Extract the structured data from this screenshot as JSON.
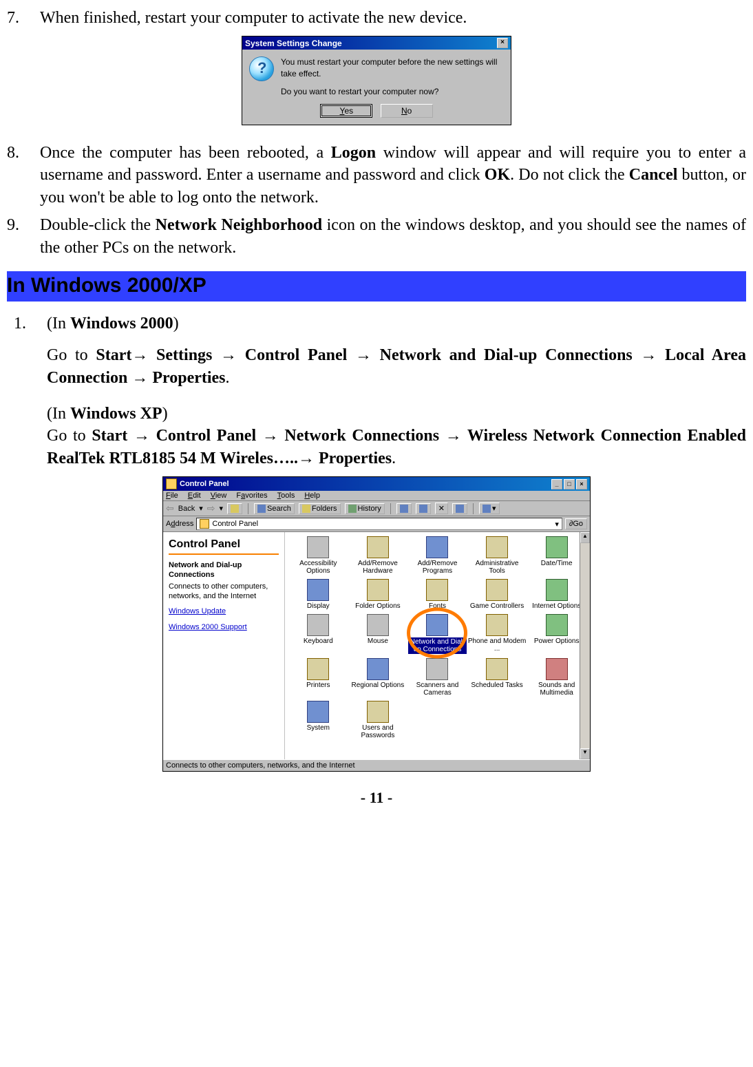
{
  "step7": {
    "num": "7.",
    "text": "When finished, restart your computer to activate the new device."
  },
  "dialog": {
    "title": "System Settings Change",
    "close": "×",
    "line1": "You must restart your computer before the new settings will take effect.",
    "line2": "Do you want to restart your computer now?",
    "yes_u": "Y",
    "yes_rest": "es",
    "no_u": "N",
    "no_rest": "o"
  },
  "step8": {
    "num": "8.",
    "pre": "Once the computer has been rebooted, a ",
    "logon": "Logon",
    "mid1": " window will appear and will require you to enter a username and password. Enter a username and password and click ",
    "ok": "OK",
    "mid2": ".  Do not click the ",
    "cancel": "Cancel",
    "tail": " button, or you won't be able to log onto the network."
  },
  "step9": {
    "num": "9.",
    "pre": "Double-click the ",
    "nn": "Network Neighborhood",
    "tail": " icon on the windows desktop, and you should see the names of the other PCs on the network."
  },
  "section_header": "In Windows 2000/XP",
  "step1": {
    "num": "1.",
    "paren_pre": "(In ",
    "w2000": "Windows 2000",
    "paren_post": ")",
    "w2000_path_pre": "Go to ",
    "w2000_path": "Start→ Settings → Control Panel → Network and Dial-up Connections → Local Area Connection → Properties",
    "dot1": ".",
    "wxp_paren_pre": "(In ",
    "wxp": "Windows XP",
    "wxp_paren_post": ")",
    "wxp_path_pre": "Go to ",
    "wxp_path": "Start → Control Panel → Network Connections → Wireless Network Connection Enabled RealTek RTL8185 54 M Wireles…..→ Properties",
    "dot2": "."
  },
  "cp": {
    "title": "Control Panel",
    "menu": {
      "file": "File",
      "edit": "Edit",
      "view": "View",
      "fav": "Favorites",
      "tools": "Tools",
      "help": "Help"
    },
    "toolbar": {
      "back": "Back",
      "search": "Search",
      "folders": "Folders",
      "history": "History"
    },
    "address_label": "Address",
    "address_value": "Control Panel",
    "go": "Go",
    "left": {
      "title": "Control Panel",
      "head": "Network and Dial-up Connections",
      "desc": "Connects to other computers, networks, and the Internet",
      "link1": "Windows Update",
      "link2": "Windows 2000 Support"
    },
    "items": [
      {
        "label": "Accessibility Options",
        "cls": "grey"
      },
      {
        "label": "Add/Remove Hardware",
        "cls": ""
      },
      {
        "label": "Add/Remove Programs",
        "cls": "blue"
      },
      {
        "label": "Administrative Tools",
        "cls": ""
      },
      {
        "label": "Date/Time",
        "cls": "green"
      },
      {
        "label": "Display",
        "cls": "blue"
      },
      {
        "label": "Folder Options",
        "cls": ""
      },
      {
        "label": "Fonts",
        "cls": ""
      },
      {
        "label": "Game Controllers",
        "cls": ""
      },
      {
        "label": "Internet Options",
        "cls": "green"
      },
      {
        "label": "Keyboard",
        "cls": "grey"
      },
      {
        "label": "Mouse",
        "cls": "grey"
      },
      {
        "label": "Network and Dial-up Connections",
        "cls": "blue",
        "highlight": true
      },
      {
        "label": "Phone and Modem ...",
        "cls": ""
      },
      {
        "label": "Power Options",
        "cls": "green"
      },
      {
        "label": "Printers",
        "cls": ""
      },
      {
        "label": "Regional Options",
        "cls": "blue"
      },
      {
        "label": "Scanners and Cameras",
        "cls": "grey"
      },
      {
        "label": "Scheduled Tasks",
        "cls": ""
      },
      {
        "label": "Sounds and Multimedia",
        "cls": "red"
      },
      {
        "label": "System",
        "cls": "blue"
      },
      {
        "label": "Users and Passwords",
        "cls": ""
      }
    ],
    "status": "Connects to other computers, networks, and the Internet",
    "winbtns": {
      "min": "_",
      "max": "□",
      "close": "×"
    },
    "scroll": {
      "up": "▲",
      "down": "▼"
    }
  },
  "footer": "- 11 -"
}
